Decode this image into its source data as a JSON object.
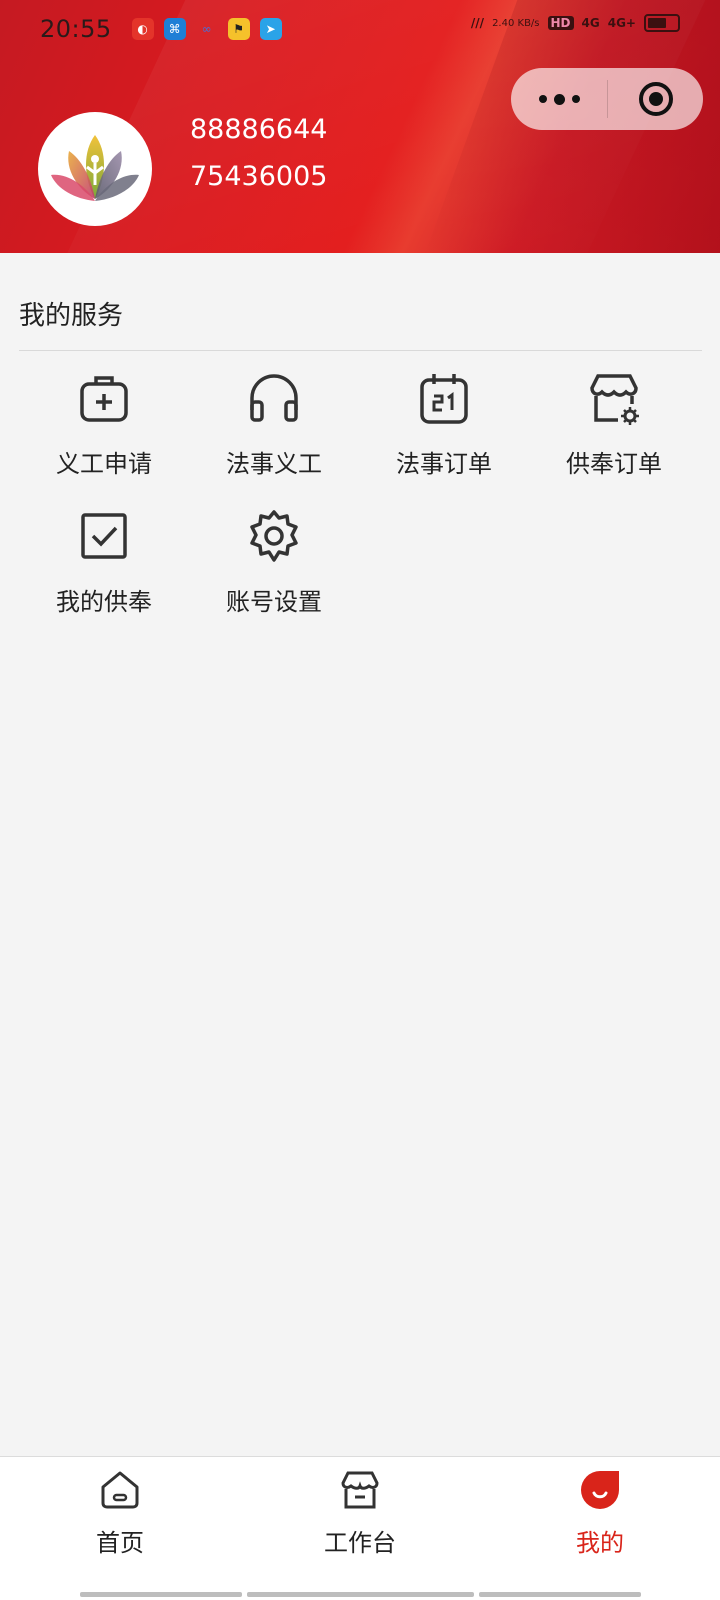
{
  "status_bar": {
    "time": "20:55",
    "speed": "2.40 KB/s",
    "network_a": "HD",
    "network_b": "4G",
    "network_c": "4G+"
  },
  "header": {
    "user_id": "88886644",
    "user_number": "75436005",
    "capsule_icons": [
      "more-icon",
      "close-miniprogram-icon"
    ]
  },
  "services": {
    "title": "我的服务",
    "items": [
      {
        "label": "义工申请",
        "icon": "medical-bag-plus-icon"
      },
      {
        "label": "法事义工",
        "icon": "headphones-icon"
      },
      {
        "label": "法事订单",
        "icon": "calendar-21-icon"
      },
      {
        "label": "供奉订单",
        "icon": "store-settings-icon"
      },
      {
        "label": "我的供奉",
        "icon": "checkbox-icon"
      },
      {
        "label": "账号设置",
        "icon": "gear-icon"
      }
    ]
  },
  "tabbar": {
    "items": [
      {
        "label": "首页",
        "icon": "home-icon",
        "active": false
      },
      {
        "label": "工作台",
        "icon": "store-icon",
        "active": false
      },
      {
        "label": "我的",
        "icon": "profile-icon",
        "active": true
      }
    ],
    "active_color": "#d9241a"
  },
  "colors": {
    "header": "#d91a1f",
    "background": "#f4f4f4",
    "accent": "#d9241a"
  }
}
